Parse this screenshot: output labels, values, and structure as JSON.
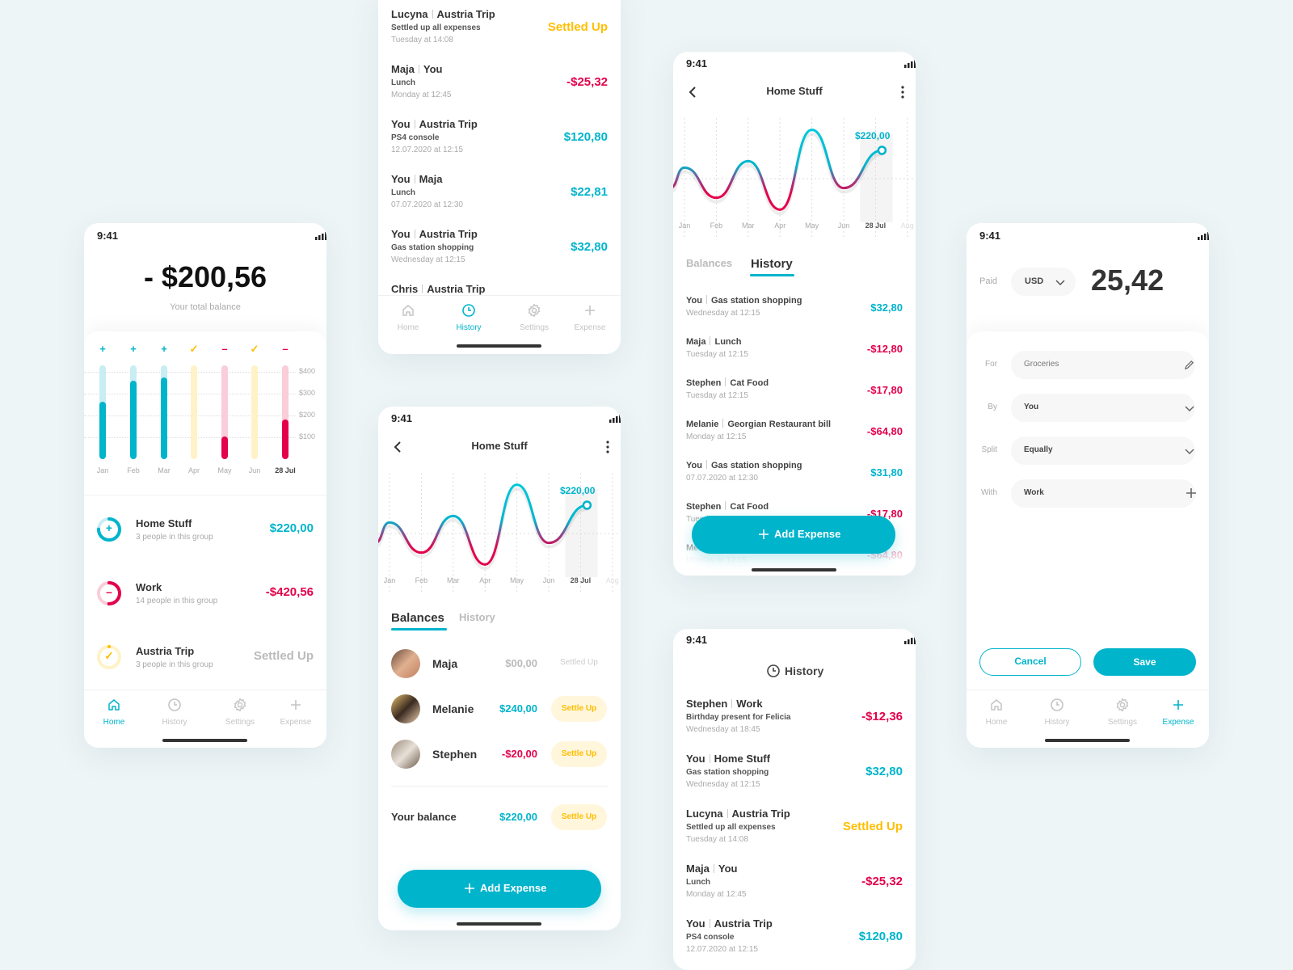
{
  "colors": {
    "accent": "#00b4cc",
    "negative": "#e4004b",
    "settled": "#ffbe00",
    "background": "#eef5f7"
  },
  "status_time": "9:41",
  "nav": {
    "items": [
      {
        "label": "Home",
        "icon": "home-icon"
      },
      {
        "label": "History",
        "icon": "clock-icon"
      },
      {
        "label": "Settings",
        "icon": "gear-icon"
      },
      {
        "label": "Expense",
        "icon": "plus-icon"
      }
    ]
  },
  "home": {
    "balance": "- $200,56",
    "balance_label": "Your total balance",
    "active_nav": 0,
    "groups": [
      {
        "name": "Home Stuff",
        "subtitle": "3 people in this group",
        "amount": "$220,00",
        "type": "positive",
        "icon": "plus-icon",
        "progress": 0.75
      },
      {
        "name": "Work",
        "subtitle": "14 people in this group",
        "amount": "-$420,56",
        "type": "negative",
        "icon": "minus-icon",
        "progress": 0.5
      },
      {
        "name": "Austria Trip",
        "subtitle": "3 people in this group",
        "amount": "Settled Up",
        "type": "settled-grey",
        "icon": "check-icon",
        "progress": 0
      }
    ]
  },
  "history_top": {
    "active_nav": 1,
    "rows": [
      {
        "who": "Lucyna",
        "group": "Austria Trip",
        "desc": "Settled up all expenses",
        "date": "Tuesday at 14:08",
        "amount": "Settled Up",
        "type": "settled"
      },
      {
        "who": "Maja",
        "group": "You",
        "desc": "Lunch",
        "date": "Monday at 12:45",
        "amount": "-$25,32",
        "type": "negative"
      },
      {
        "who": "You",
        "group": "Austria Trip",
        "desc": "PS4 console",
        "date": "12.07.2020 at 12:15",
        "amount": "$120,80",
        "type": "positive"
      },
      {
        "who": "You",
        "group": "Maja",
        "desc": "Lunch",
        "date": "07.07.2020 at 12:30",
        "amount": "$22,81",
        "type": "positive"
      },
      {
        "who": "You",
        "group": "Austria Trip",
        "desc": "Gas station shopping",
        "date": "Wednesday at 12:15",
        "amount": "$32,80",
        "type": "positive"
      },
      {
        "who": "Chris",
        "group": "Austria Trip"
      }
    ]
  },
  "group_balances": {
    "title": "Home Stuff",
    "tabs": [
      "Balances",
      "History"
    ],
    "active_tab": 0,
    "members": [
      {
        "name": "Maja",
        "amount": "$00,00",
        "type": "zero",
        "action": "Settled Up"
      },
      {
        "name": "Melanie",
        "amount": "$240,00",
        "type": "positive",
        "action": "Settle Up"
      },
      {
        "name": "Stephen",
        "amount": "-$20,00",
        "type": "negative",
        "action": "Settle Up"
      }
    ],
    "your_balance_label": "Your balance",
    "your_balance": "$220,00",
    "your_balance_action": "Settle Up",
    "add_expense": "Add Expense"
  },
  "group_history": {
    "title": "Home Stuff",
    "tabs": [
      "Balances",
      "History"
    ],
    "active_tab": 1,
    "rows": [
      {
        "who": "You",
        "item": "Gas station shopping",
        "date": "Wednesday at 12:15",
        "amount": "$32,80",
        "type": "positive"
      },
      {
        "who": "Maja",
        "item": "Lunch",
        "date": "Tuesday at 12:15",
        "amount": "-$12,80",
        "type": "negative"
      },
      {
        "who": "Stephen",
        "item": "Cat Food",
        "date": "Tuesday at 12:15",
        "amount": "-$17,80",
        "type": "negative"
      },
      {
        "who": "Melanie",
        "item": "Georgian Restaurant bill",
        "date": "Monday at 12:15",
        "amount": "-$64,80",
        "type": "negative"
      },
      {
        "who": "You",
        "item": "Gas station shopping",
        "date": "07.07.2020 at 12:30",
        "amount": "$31,80",
        "type": "positive"
      },
      {
        "who": "Stephen",
        "item": "Cat Food",
        "date": "Tuesday at 12:15",
        "amount": "-$17,80",
        "type": "negative"
      },
      {
        "who": "Melanie",
        "item": "Georgian Restaurant bill",
        "date": "Monday at 12:15",
        "amount": "-$64,80",
        "type": "negative"
      }
    ],
    "add_expense": "Add Expense"
  },
  "history_bottom": {
    "title": "History",
    "rows": [
      {
        "who": "Stephen",
        "group": "Work",
        "desc": "Birthday present for Felicia",
        "date": "Wednesday at 18:45",
        "amount": "-$12,36",
        "type": "negative"
      },
      {
        "who": "You",
        "group": "Home Stuff",
        "desc": "Gas station shopping",
        "date": "Wednesday at 12:15",
        "amount": "$32,80",
        "type": "positive"
      },
      {
        "who": "Lucyna",
        "group": "Austria Trip",
        "desc": "Settled up all expenses",
        "date": "Tuesday at 14:08",
        "amount": "Settled Up",
        "type": "settled"
      },
      {
        "who": "Maja",
        "group": "You",
        "desc": "Lunch",
        "date": "Monday at 12:45",
        "amount": "-$25,32",
        "type": "negative"
      },
      {
        "who": "You",
        "group": "Austria Trip",
        "desc": "PS4 console",
        "date": "12.07.2020 at 12:15",
        "amount": "$120,80",
        "type": "positive"
      }
    ]
  },
  "add_expense_form": {
    "active_nav": 3,
    "paid_label": "Paid",
    "currency": "USD",
    "amount": "25,42",
    "fields": [
      {
        "label": "For",
        "value": "Groceries",
        "icon": "pencil-icon"
      },
      {
        "label": "By",
        "value": "You",
        "icon": "chevron-down-icon"
      },
      {
        "label": "Split",
        "value": "Equally",
        "icon": "chevron-down-icon"
      },
      {
        "label": "With",
        "value": "Work",
        "icon": "plus-icon"
      }
    ],
    "cancel": "Cancel",
    "save": "Save"
  },
  "chart_data": [
    {
      "type": "bar",
      "categories": [
        "Jan",
        "Feb",
        "Mar",
        "Apr",
        "May",
        "Jun",
        "28 Jul"
      ],
      "values": [
        263,
        358,
        376,
        0,
        102,
        0,
        180
      ],
      "status": [
        "plus",
        "plus",
        "plus",
        "check",
        "minus",
        "check",
        "minus"
      ],
      "series_colors": [
        "#00b4cc",
        "#00b4cc",
        "#00b4cc",
        "#ffbe00",
        "#e4004b",
        "#ffbe00",
        "#e4004b"
      ],
      "ytick_labels": [
        "$400",
        "$300",
        "$200",
        "$100"
      ],
      "yticks": [
        400,
        300,
        200,
        100
      ],
      "ylim": [
        0,
        430
      ],
      "highlight": "28 Jul",
      "grid": true
    },
    {
      "type": "line",
      "x_labels": [
        "Jan",
        "Feb",
        "Mar",
        "Apr",
        "May",
        "Jun",
        "28 Jul",
        "Aug"
      ],
      "values": [
        188,
        132,
        200,
        110,
        258,
        150,
        220
      ],
      "annotation": "$220,00",
      "highlight": "28 Jul",
      "grid": true
    }
  ]
}
